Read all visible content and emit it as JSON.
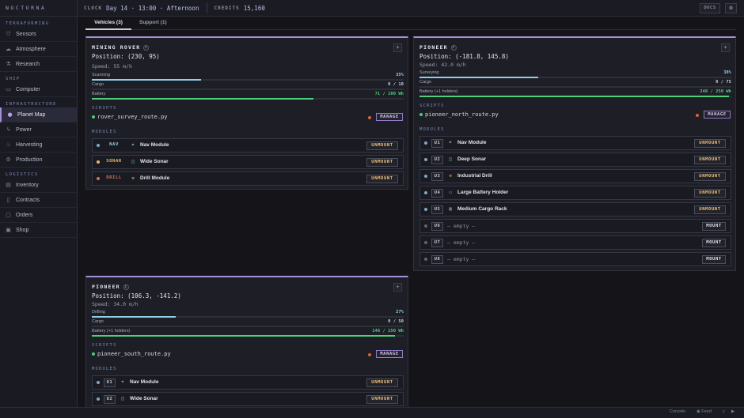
{
  "app": {
    "name": "NOCTURNA"
  },
  "topbar": {
    "clock_label": "CLOCK",
    "clock_value": "Day 14 · 13:00 · Afternoon",
    "credits_label": "CREDITS",
    "credits_value": "15,160",
    "docs_label": "DOCS",
    "settings_icon": "gear-icon"
  },
  "sidebar": {
    "sections": [
      {
        "title": "TERRAFORMING",
        "items": [
          {
            "label": "Sensors",
            "icon": "sensors-icon"
          },
          {
            "label": "Atmosphere",
            "icon": "atmosphere-icon"
          },
          {
            "label": "Research",
            "icon": "research-icon"
          }
        ]
      },
      {
        "title": "SHIP",
        "items": [
          {
            "label": "Computer",
            "icon": "computer-icon"
          }
        ]
      },
      {
        "title": "INFRASTRUCTURE",
        "items": [
          {
            "label": "Planet Map",
            "icon": "planet-icon",
            "active": true
          },
          {
            "label": "Power",
            "icon": "power-icon"
          },
          {
            "label": "Harvesting",
            "icon": "harvesting-icon"
          },
          {
            "label": "Production",
            "icon": "production-icon"
          }
        ]
      },
      {
        "title": "LOGISTICS",
        "items": [
          {
            "label": "Inventory",
            "icon": "inventory-icon"
          },
          {
            "label": "Contracts",
            "icon": "contracts-icon"
          },
          {
            "label": "Orders",
            "icon": "orders-icon"
          },
          {
            "label": "Shop",
            "icon": "shop-icon"
          }
        ]
      }
    ]
  },
  "tabs": [
    {
      "label": "Vehicles (3)",
      "active": true
    },
    {
      "label": "Support (1)",
      "active": false
    }
  ],
  "panels": {
    "rover": {
      "title": "MINING ROVER",
      "position": "Position: (230, 95)",
      "speed": "Speed: 55 m/h",
      "bars": [
        {
          "label": "Scanning",
          "value": "35%",
          "fraction": 0.35,
          "kind": "scan"
        },
        {
          "label": "Cargo",
          "value": "0 / 10",
          "fraction": 0,
          "kind": "cargo"
        },
        {
          "label": "Battery",
          "value": "71 / 100 Wh",
          "fraction": 0.71,
          "kind": "bat"
        }
      ],
      "scripts_label": "SCRIPTS",
      "script": "rover_survey_route.py",
      "manage_label": "MANAGE",
      "modules_label": "MODULES",
      "modules": [
        {
          "slot": "NAV",
          "slot_kind": "nav",
          "name": "Nav Module",
          "action": "UNMOUNT"
        },
        {
          "slot": "SONAR",
          "slot_kind": "sonar",
          "name": "Wide Sonar",
          "action": "UNMOUNT"
        },
        {
          "slot": "DRILL",
          "slot_kind": "drill",
          "name": "Drill Module",
          "action": "UNMOUNT"
        }
      ]
    },
    "pioneer_north": {
      "title": "PIONEER",
      "position": "Position: (-181.8, 145.8)",
      "speed": "Speed: 42.0 m/h",
      "bars": [
        {
          "label": "Surveying",
          "value": "38%",
          "fraction": 0.38,
          "kind": "scan"
        },
        {
          "label": "Cargo",
          "value": "0 / 75",
          "fraction": 0,
          "kind": "cargo"
        },
        {
          "label": "Battery (+1 holders)",
          "value": "248 / 250 Wh",
          "fraction": 0.992,
          "kind": "bat"
        }
      ],
      "scripts_label": "SCRIPTS",
      "script": "pioneer_north_route.py",
      "manage_label": "MANAGE",
      "modules_label": "MODULES",
      "modules": [
        {
          "slot": "U1",
          "name": "Nav Module",
          "action": "UNMOUNT"
        },
        {
          "slot": "U2",
          "name": "Deep Sonar",
          "action": "UNMOUNT"
        },
        {
          "slot": "U3",
          "name": "Industrial Drill",
          "action": "UNMOUNT"
        },
        {
          "slot": "U4",
          "name": "Large Battery Holder",
          "action": "UNMOUNT"
        },
        {
          "slot": "U5",
          "name": "Medium Cargo Rack",
          "action": "UNMOUNT"
        },
        {
          "slot": "U6",
          "name": "— empty —",
          "action": "MOUNT",
          "empty": true
        },
        {
          "slot": "U7",
          "name": "— empty —",
          "action": "MOUNT",
          "empty": true
        },
        {
          "slot": "U8",
          "name": "— empty —",
          "action": "MOUNT",
          "empty": true
        }
      ]
    },
    "pioneer_south": {
      "title": "PIONEER",
      "position": "Position: (106.3, -141.2)",
      "speed": "Speed: 34.0 m/h",
      "bars": [
        {
          "label": "Drilling",
          "value": "27%",
          "fraction": 0.27,
          "kind": "scan"
        },
        {
          "label": "Cargo",
          "value": "0 / 50",
          "fraction": 0,
          "kind": "cargo"
        },
        {
          "label": "Battery (+1 holders)",
          "value": "146 / 150 Wh",
          "fraction": 0.973,
          "kind": "bat"
        }
      ],
      "scripts_label": "SCRIPTS",
      "script": "pioneer_south_route.py",
      "manage_label": "MANAGE",
      "modules_label": "MODULES",
      "modules": [
        {
          "slot": "U1",
          "name": "Nav Module",
          "action": "UNMOUNT"
        },
        {
          "slot": "U2",
          "name": "Wide Sonar",
          "action": "UNMOUNT"
        }
      ]
    }
  },
  "statusbar": {
    "console_label": "Console",
    "feed_label": "Feed"
  },
  "colors": {
    "accent": "#a794d6",
    "battery": "#4fcf7a",
    "scan": "#8fd0e8",
    "unmount": "#f0c27a"
  }
}
